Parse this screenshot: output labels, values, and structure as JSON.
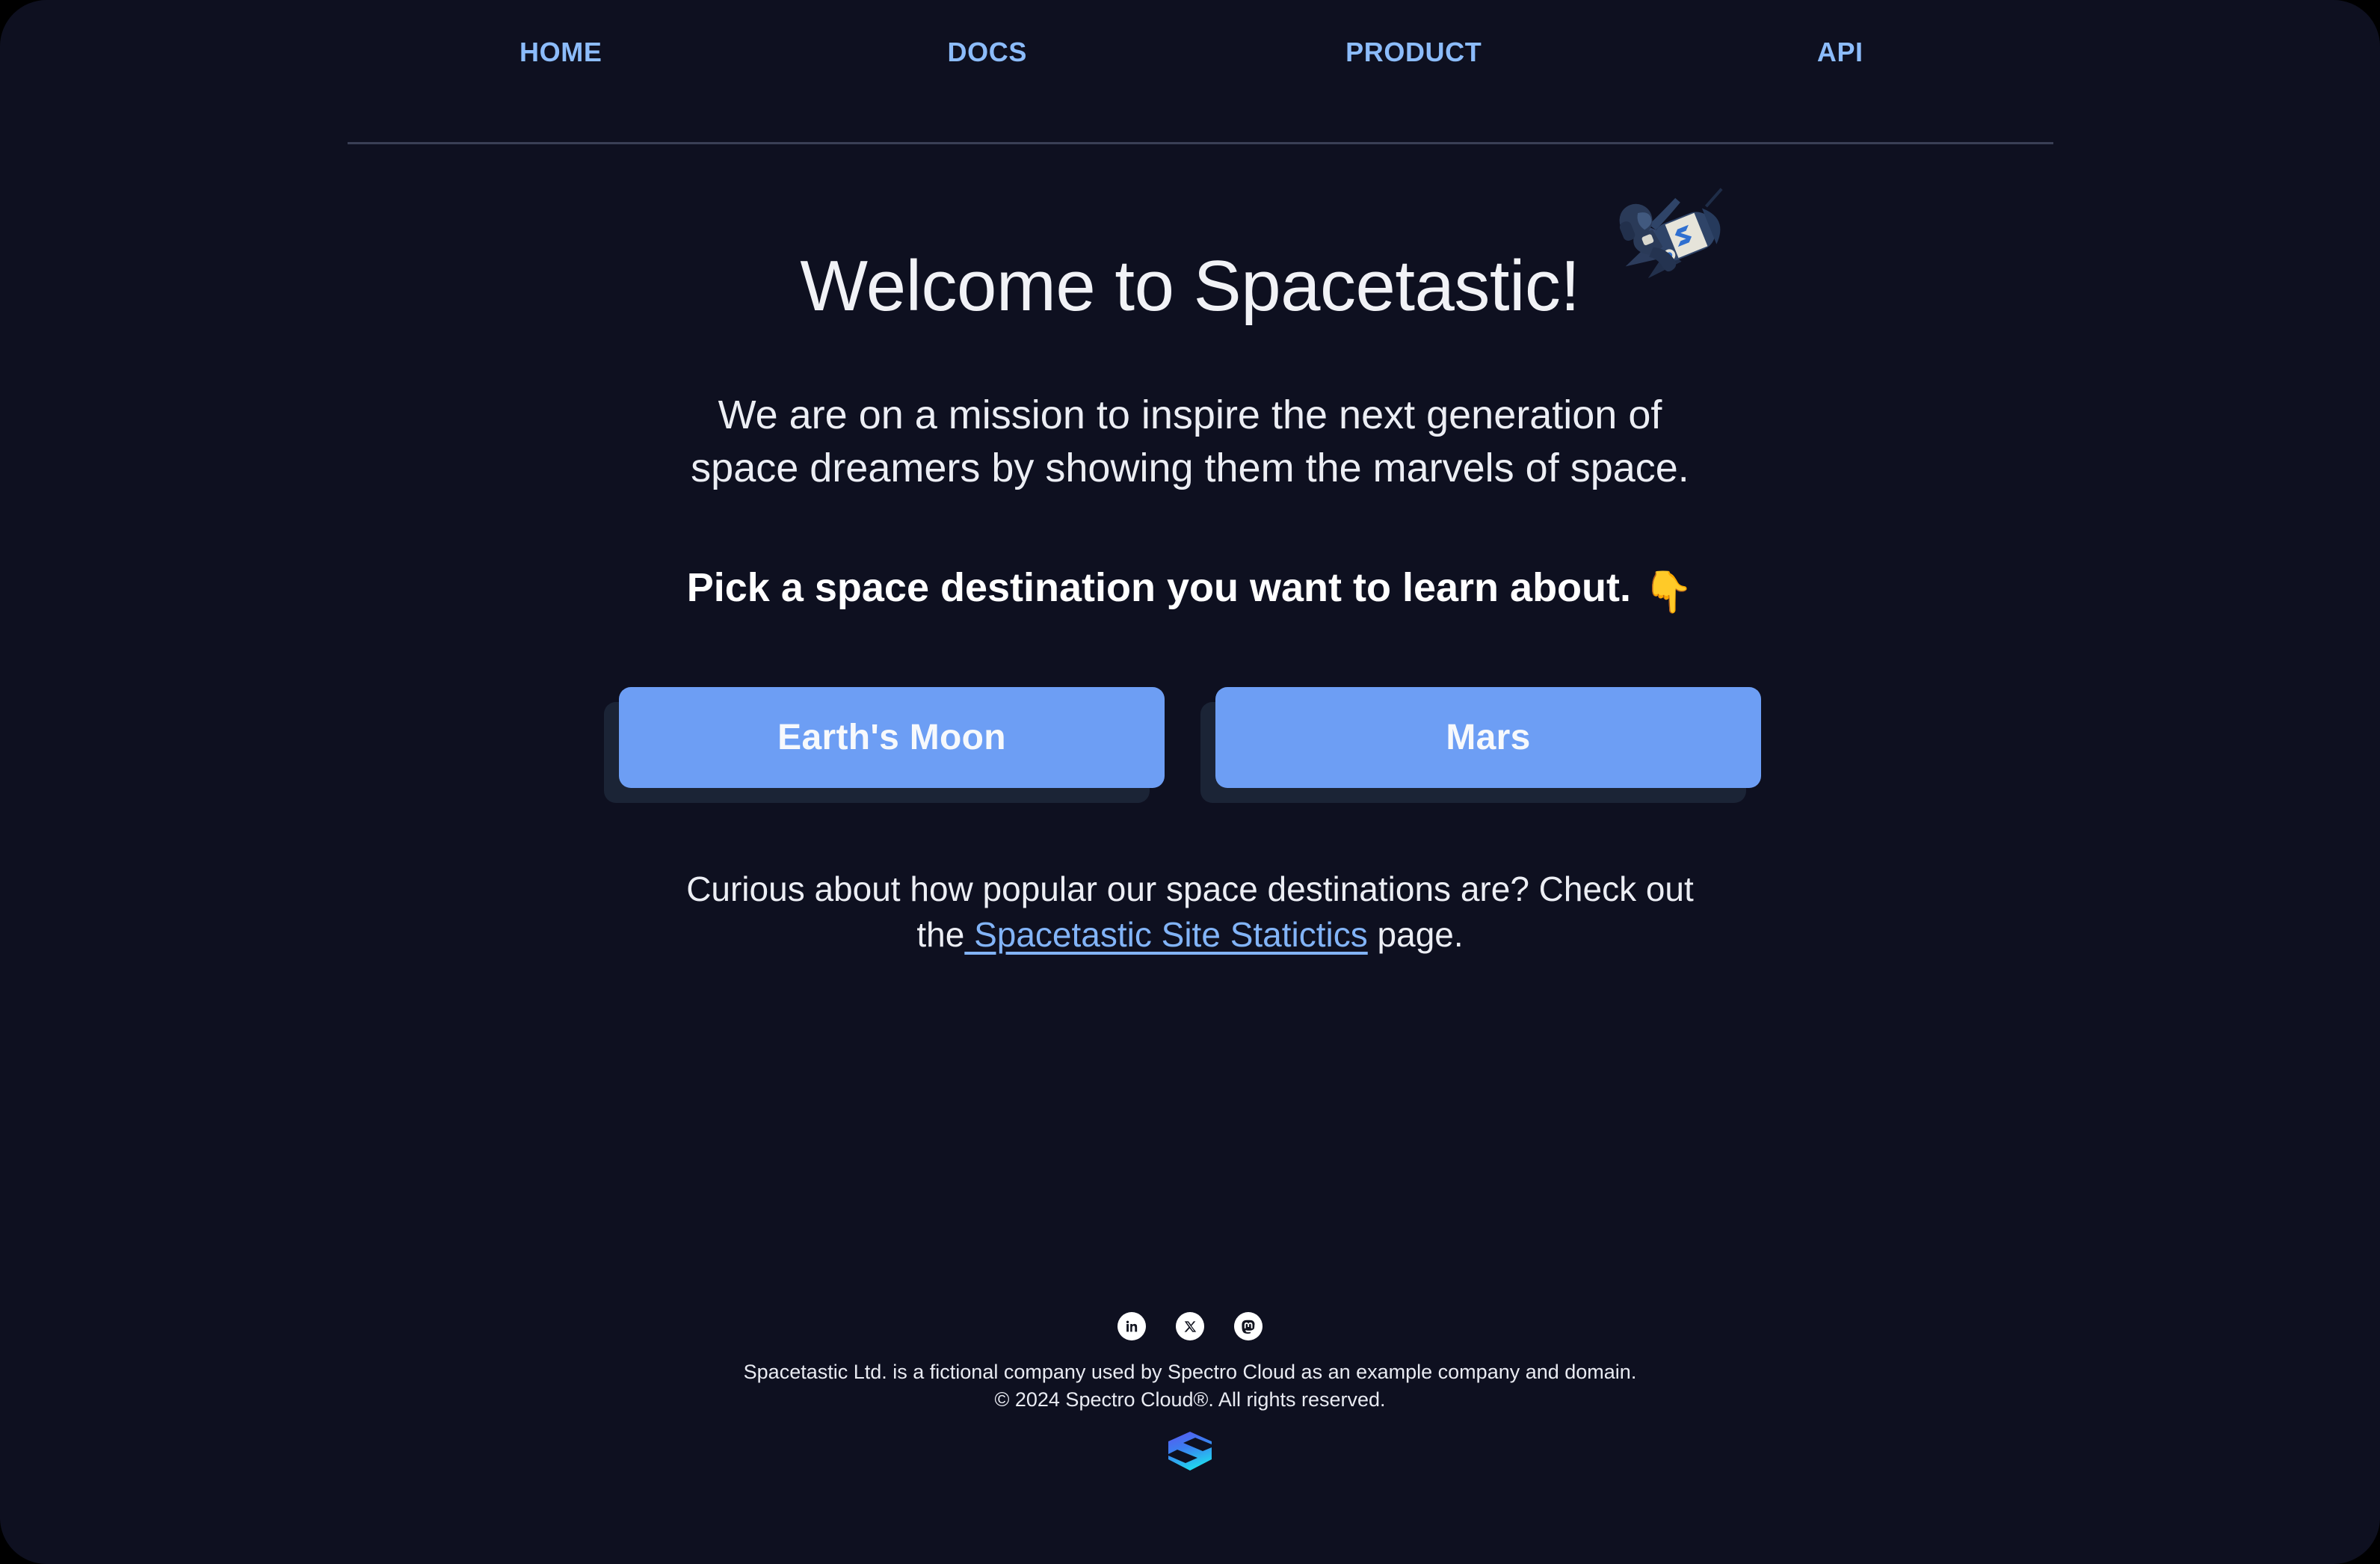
{
  "colors": {
    "page_background": "#0e1020",
    "nav_link": "#8cbcfb",
    "button_background": "#6d9ef4",
    "button_shadow": "#1b2436",
    "link": "#82b4f8",
    "body_text": "#eceef4",
    "divider": "#3a3f55",
    "logo_gradient_start": "#4f46e5",
    "logo_gradient_end": "#22d3ee"
  },
  "nav": {
    "items": [
      {
        "label": "HOME",
        "name": "nav-link-home"
      },
      {
        "label": "DOCS",
        "name": "nav-link-docs"
      },
      {
        "label": "PRODUCT",
        "name": "nav-link-product"
      },
      {
        "label": "API",
        "name": "nav-link-api"
      }
    ]
  },
  "hero": {
    "title": "Welcome to Spacetastic!",
    "rocket_icon": "astronaut-rocket-icon",
    "mission_line_1": "We are on a mission to inspire the next generation of",
    "mission_line_2": "space dreamers by showing them the marvels of space.",
    "pick_text": "Pick a space destination you want to learn about.",
    "pick_emoji": "👇",
    "buttons": [
      {
        "label": "Earth's Moon",
        "name": "destination-button-earths-moon"
      },
      {
        "label": "Mars",
        "name": "destination-button-mars"
      }
    ],
    "stats_line_1": "Curious about how popular our space destinations are? Check out",
    "stats_prefix": "the",
    "stats_link_label": " Spacetastic Site Statictics",
    "stats_suffix": " page."
  },
  "footer": {
    "social": [
      {
        "name": "linkedin-icon",
        "label": "LinkedIn"
      },
      {
        "name": "x-twitter-icon",
        "label": "X"
      },
      {
        "name": "mastodon-icon",
        "label": "Mastodon"
      }
    ],
    "disclaimer": "Spacetastic Ltd. is a fictional company used by Spectro Cloud as an example company and domain.",
    "copyright": "© 2024 Spectro Cloud®. All rights reserved.",
    "brand_logo": "spectro-cloud-logo"
  }
}
